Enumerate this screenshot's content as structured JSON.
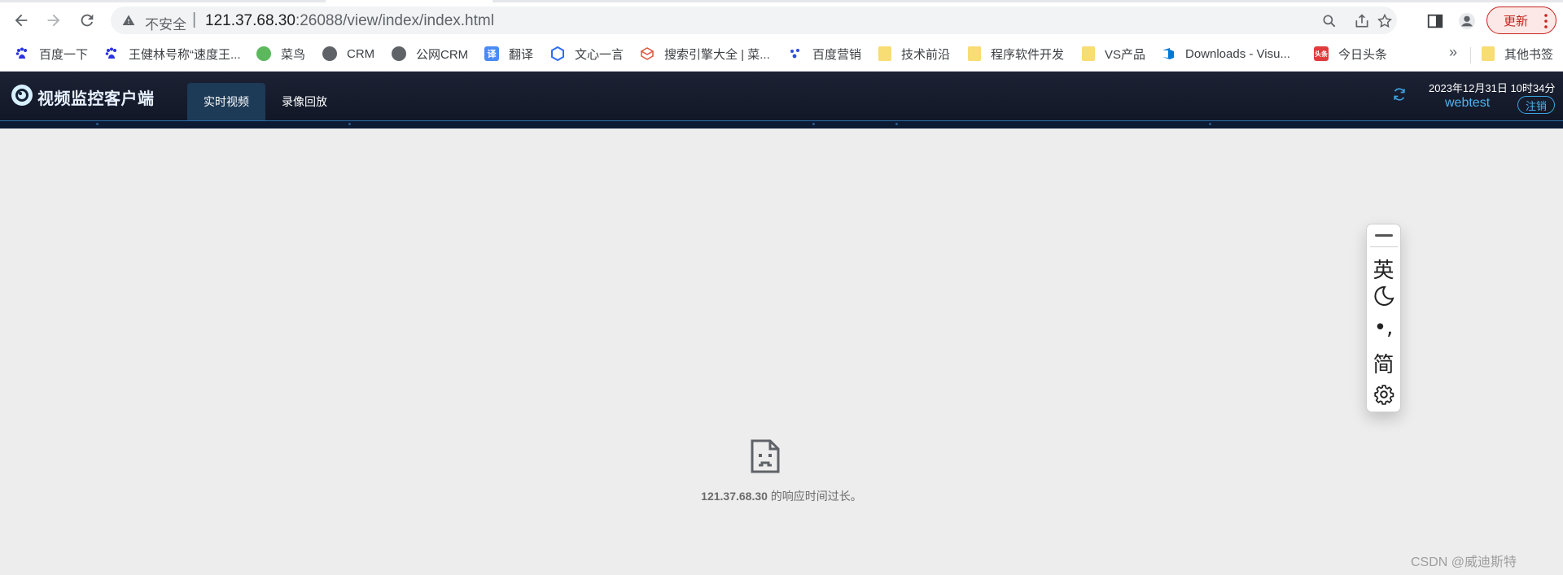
{
  "browser": {
    "address": {
      "security_label": "不安全",
      "separator": "|",
      "host": "121.37.68.30",
      "rest": ":26088/view/index/index.html"
    },
    "update_label": "更新",
    "bookmarks": [
      {
        "label": "百度一下",
        "icon": "baidu-paw-icon"
      },
      {
        "label": "王健林号称“速度王...",
        "icon": "baidu-paw-icon"
      },
      {
        "label": "菜鸟",
        "icon": "runoob-icon"
      },
      {
        "label": "CRM",
        "icon": "globe-icon"
      },
      {
        "label": "公网CRM",
        "icon": "globe-icon"
      },
      {
        "label": "翻译",
        "icon": "translate-icon"
      },
      {
        "label": "文心一言",
        "icon": "wenxin-icon"
      },
      {
        "label": "搜索引擎大全 | 菜...",
        "icon": "cube-icon"
      },
      {
        "label": "百度营销",
        "icon": "baidu-marketing-icon"
      },
      {
        "label": "技术前沿",
        "icon": "folder-icon"
      },
      {
        "label": "程序软件开发",
        "icon": "folder-icon"
      },
      {
        "label": "VS产品",
        "icon": "folder-icon"
      },
      {
        "label": "Downloads - Visu...",
        "icon": "azure-devops-icon"
      },
      {
        "label": "今日头条",
        "icon": "toutiao-icon"
      }
    ],
    "bookmarks_more": "»",
    "other_bookmarks": "其他书签",
    "translate_icon_glyph": "译",
    "toutiao_icon_glyph": "头条"
  },
  "app": {
    "title": "视频监控客户端",
    "tabs": [
      {
        "label": "实时视频",
        "active": true
      },
      {
        "label": "录像回放",
        "active": false
      }
    ],
    "datetime": "2023年12月31日 10时34分",
    "username": "webtest",
    "logout_label": "注销",
    "accent_color": "#4fb3f0"
  },
  "error": {
    "host": "121.37.68.30",
    "message": " 的响应时间过长。"
  },
  "ime": {
    "lang": "英",
    "punct": "•,",
    "script": "简"
  },
  "watermark": "CSDN @威迪斯特"
}
